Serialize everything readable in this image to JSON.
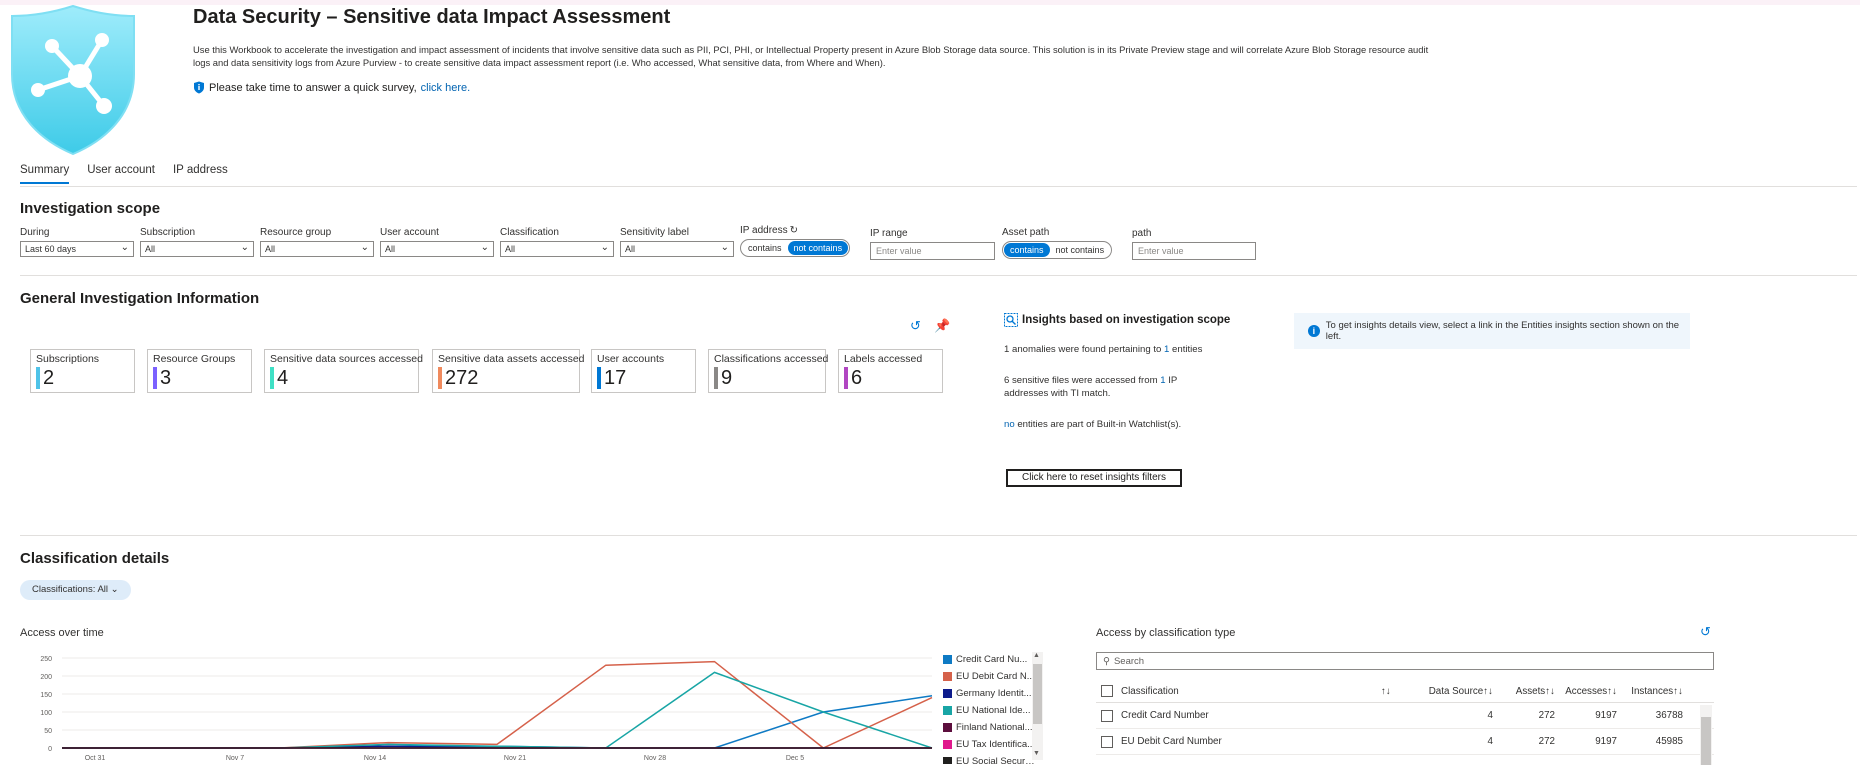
{
  "header": {
    "title": "Data Security – Sensitive data Impact Assessment",
    "description": "Use this Workbook to accelerate the investigation and impact assessment of incidents that involve sensitive data such as PII, PCI, PHI, or Intellectual Property present in Azure Blob Storage data source. This solution is in its Private Preview stage and will correlate Azure Blob Storage resource audit logs and data sensitivity logs from Azure Purview - to create sensitive data impact assessment report (i.e. Who accessed, What sensitive data, from Where and When).",
    "survey_text": "Please take time to answer a quick survey,",
    "survey_link": "click here."
  },
  "tabs": [
    "Summary",
    "User account",
    "IP address"
  ],
  "investigation_scope": {
    "title": "Investigation scope",
    "params": [
      {
        "label": "During",
        "value": "Last 60 days"
      },
      {
        "label": "Subscription",
        "value": "All"
      },
      {
        "label": "Resource group",
        "value": "All"
      },
      {
        "label": "User account",
        "value": "All"
      },
      {
        "label": "Classification",
        "value": "All"
      },
      {
        "label": "Sensitivity label",
        "value": "All"
      }
    ],
    "ip_address": {
      "label": "IP address",
      "opt1": "contains",
      "opt2": "not contains"
    },
    "ip_range": {
      "label": "IP range",
      "placeholder": "Enter value"
    },
    "asset_path": {
      "label": "Asset path",
      "opt1": "contains",
      "opt2": "not contains"
    },
    "path": {
      "label": "path",
      "placeholder": "Enter value"
    }
  },
  "general": {
    "title": "General Investigation Information",
    "tiles": [
      {
        "label": "Subscriptions",
        "value": "2",
        "color": "#4fc3e8"
      },
      {
        "label": "Resource Groups",
        "value": "3",
        "color": "#7b61ff"
      },
      {
        "label": "Sensitive data sources accessed",
        "value": "4",
        "color": "#3fe0c5"
      },
      {
        "label": "Sensitive data assets accessed",
        "value": "272",
        "color": "#f08a5d"
      },
      {
        "label": "User accounts",
        "value": "17",
        "color": "#0078d4"
      },
      {
        "label": "Classifications accessed",
        "value": "9",
        "color": "#8a8886"
      },
      {
        "label": "Labels accessed",
        "value": "6",
        "color": "#b146c2"
      }
    ]
  },
  "insights": {
    "title": "Insights based on investigation scope",
    "line1_a": "1 anomalies were found pertaining to",
    "line1_link": "1",
    "line1_b": "entities",
    "line2_a": "6 sensitive files were accessed from",
    "line2_link": "1",
    "line2_b": "IP addresses with TI match.",
    "line3_link": "no",
    "line3_b": "entities are part of Built-in Watchlist(s).",
    "reset_button": "Click here to reset insights filters",
    "info": "To get insights details view, select a link in the Entities insights section shown on the left."
  },
  "classification": {
    "title": "Classification details",
    "pill": "Classifications: All"
  },
  "chart_data": {
    "type": "line",
    "title": "Access over time",
    "x": [
      "Oct 31",
      "Nov 7",
      "Nov 14",
      "Nov 21",
      "Nov 28",
      "Dec 5"
    ],
    "ylim": [
      0,
      250
    ],
    "yticks": [
      0,
      50,
      100,
      150,
      200,
      250
    ],
    "series": [
      {
        "name": "Credit Card Nu...",
        "color": "#0e7ac4",
        "values": [
          0,
          0,
          0,
          5,
          5,
          0,
          0,
          100,
          145
        ]
      },
      {
        "name": "EU Debit Card N...",
        "color": "#d5614a",
        "values": [
          0,
          0,
          0,
          15,
          10,
          230,
          240,
          0,
          140
        ]
      },
      {
        "name": "Germany Identit...",
        "color": "#0d1b8c",
        "values": [
          0,
          0,
          0,
          5,
          0,
          0,
          0,
          0,
          0
        ]
      },
      {
        "name": "EU National Ide...",
        "color": "#18a5a5",
        "values": [
          0,
          0,
          0,
          10,
          5,
          0,
          210,
          100,
          0
        ]
      },
      {
        "name": "Finland National...",
        "color": "#5c0e3d",
        "values": [
          0,
          0,
          0,
          0,
          0,
          0,
          0,
          0,
          0
        ]
      },
      {
        "name": "EU Tax Identifica...",
        "color": "#e0188c",
        "values": [
          0,
          0,
          0,
          0,
          0,
          0,
          0,
          0,
          0
        ]
      },
      {
        "name": "EU Social Securit...",
        "color": "#201f1e",
        "values": [
          0,
          0,
          0,
          0,
          0,
          0,
          0,
          0,
          0
        ]
      }
    ]
  },
  "access_by_type": {
    "title": "Access by classification type",
    "search_placeholder": "Search",
    "columns": [
      "Classification",
      "↑↓",
      "Data Source↑↓",
      "Assets↑↓",
      "Accesses↑↓",
      "Instances↑↓"
    ],
    "rows": [
      {
        "name": "Credit Card Number",
        "ds": "4",
        "assets": "272",
        "accesses": "9197",
        "instances": "36788"
      },
      {
        "name": "EU Debit Card Number",
        "ds": "4",
        "assets": "272",
        "accesses": "9197",
        "instances": "45985"
      }
    ]
  }
}
